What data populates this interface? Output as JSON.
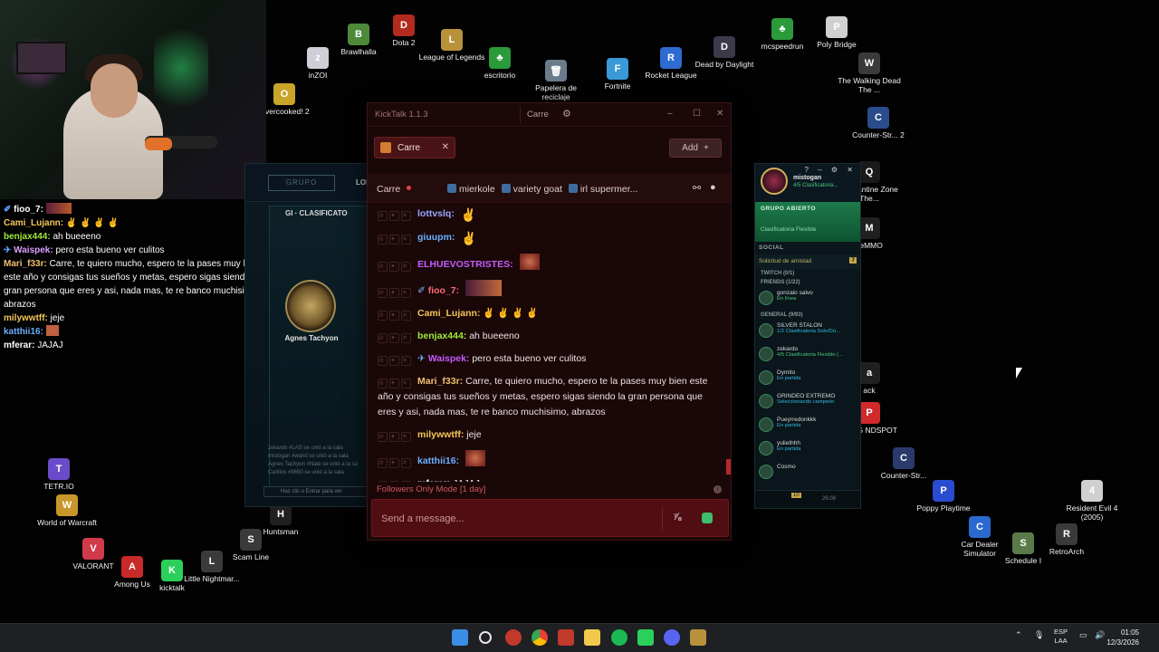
{
  "desktop_icons": [
    {
      "label": "Brawlhalla",
      "icon": "brawlhalla-icon",
      "color": "#4c8a3a",
      "glyph": "B"
    },
    {
      "label": "Dota 2",
      "icon": "dota2-icon",
      "color": "#b32a1e",
      "glyph": "D"
    },
    {
      "label": "League of Legends",
      "icon": "lol-icon",
      "color": "#b8923a",
      "glyph": "L"
    },
    {
      "label": "inZOI",
      "icon": "inzoi-icon",
      "color": "#cfcfd8",
      "glyph": "z"
    },
    {
      "label": "escritorio",
      "icon": "tree-icon",
      "color": "#2b9a3a",
      "glyph": "♣"
    },
    {
      "label": "Papelera de reciclaje",
      "icon": "recycle-bin-icon",
      "color": "#6a7c8c",
      "glyph": "🗑"
    },
    {
      "label": "Fortnite",
      "icon": "fortnite-icon",
      "color": "#3a9ad8",
      "glyph": "F"
    },
    {
      "label": "Rocket League",
      "icon": "rocket-league-icon",
      "color": "#2d6bd0",
      "glyph": "R"
    },
    {
      "label": "Dead by Daylight",
      "icon": "dbd-icon",
      "color": "#3a3a48",
      "glyph": "D"
    },
    {
      "label": "mcspeedrun",
      "icon": "tree-icon",
      "color": "#2b9a3a",
      "glyph": "♣"
    },
    {
      "label": "Poly Bridge",
      "icon": "polybridge-icon",
      "color": "#d0d0d0",
      "glyph": "P"
    },
    {
      "label": "The Walking Dead The ...",
      "icon": "twd-icon",
      "color": "#3a3a3a",
      "glyph": "W"
    },
    {
      "label": "Overcooked! 2",
      "icon": "overcooked-icon",
      "color": "#c8a52a",
      "glyph": "O"
    },
    {
      "label": "Counter-Str... 2",
      "icon": "cs2-icon",
      "color": "#2a4c8a",
      "glyph": "C"
    },
    {
      "label": "Quarantine Zone The...",
      "icon": "qz-icon",
      "color": "#1a1a1a",
      "glyph": "Q"
    },
    {
      "label": "ceMMO",
      "icon": "mmo-icon",
      "color": "#202020",
      "glyph": "M"
    },
    {
      "label": "ack",
      "icon": "app-icon",
      "color": "#202020",
      "glyph": "a"
    },
    {
      "label": "PUBG NDSPOT",
      "icon": "pubg-icon",
      "color": "#d02a2a",
      "glyph": "P"
    },
    {
      "label": "Counter-Str...",
      "icon": "cs-icon",
      "color": "#2a3a6a",
      "glyph": "C"
    },
    {
      "label": "Resident Evil 4 (2005)",
      "icon": "re4-icon",
      "color": "#d0d0d0",
      "glyph": "4"
    },
    {
      "label": "Poppy Playtime",
      "icon": "poppy-icon",
      "color": "#2a4cd0",
      "glyph": "P"
    },
    {
      "label": "Car Dealer Simulator",
      "icon": "cardealer-icon",
      "color": "#2a6ad0",
      "glyph": "C"
    },
    {
      "label": "Schedule I",
      "icon": "schedule-icon",
      "color": "#5a7a4a",
      "glyph": "S"
    },
    {
      "label": "RetroArch",
      "icon": "retroarch-icon",
      "color": "#3a3a3a",
      "glyph": "R"
    },
    {
      "label": "TETR.IO",
      "icon": "tetrio-icon",
      "color": "#6a4cc8",
      "glyph": "T"
    },
    {
      "label": "World of Warcraft",
      "icon": "wow-icon",
      "color": "#c8962a",
      "glyph": "W"
    },
    {
      "label": "VALORANT",
      "icon": "valorant-icon",
      "color": "#d03a4a",
      "glyph": "V"
    },
    {
      "label": "Among Us",
      "icon": "amongus-icon",
      "color": "#c82a2a",
      "glyph": "A"
    },
    {
      "label": "kicktalk",
      "icon": "kicktalk-icon",
      "color": "#2ad05a",
      "glyph": "K"
    },
    {
      "label": "Little Nightmar...",
      "icon": "ln-icon",
      "color": "#3a3a3a",
      "glyph": "L"
    },
    {
      "label": "Scam Line",
      "icon": "scamline-icon",
      "color": "#3a3a3a",
      "glyph": "S"
    },
    {
      "label": "Huntsman",
      "icon": "huntsman-icon",
      "color": "#202020",
      "glyph": "H"
    }
  ],
  "overlay_chat": [
    {
      "user": "fioo_7:",
      "color": "#ffffff",
      "text": "",
      "badge": "✐",
      "emote": "block"
    },
    {
      "user": "Cami_Lujann:",
      "color": "#f5c65a",
      "text": "✌ ✌ ✌ ✌",
      "badge": "",
      "emote": ""
    },
    {
      "user": "benjax444:",
      "color": "#9eea3a",
      "text": "ah bueeeno",
      "badge": "",
      "emote": ""
    },
    {
      "user": "Waispek:",
      "color": "#d9a0ff",
      "text": "pero esta bueno ver culitos",
      "badge": "✈",
      "emote": ""
    },
    {
      "user": "Mari_f33r:",
      "color": "#f0c070",
      "text": "Carre, te quiero mucho, espero te la pases muy bien este año y consigas tus sueños y metas, espero sigas siendo la gran persona que eres y asi, nada mas, te re banco muchisimo, abrazos",
      "badge": "",
      "emote": ""
    },
    {
      "user": "milywwtff:",
      "color": "#f5c65a",
      "text": "jeje",
      "badge": "",
      "emote": ""
    },
    {
      "user": "katthii16:",
      "color": "#6ab0ff",
      "text": "",
      "badge": "",
      "emote": "face"
    },
    {
      "user": "mferar:",
      "color": "#ffffff",
      "text": "JAJAJ",
      "badge": "",
      "emote": ""
    }
  ],
  "lol_client": {
    "grupo": "GRUPO",
    "lol_label": "LOL",
    "title": "GI · CLASIFICATO",
    "name": "Agnes Tachyon",
    "log": "zekardo #LAS se unió a la sala\nmistogan #wand se unió a la sala\nAgnes Tachyon #Nate se unió a la sa\nCarlitos #9650 se unió a la sala",
    "hint": "Haz clic o Entrar para ver"
  },
  "social_panel": {
    "username": "mistogan",
    "status": "4/5 Clasificatoria...",
    "group_title": "GRUPO ABIERTO",
    "group_sub": "Clasificatoria Flexible",
    "social_label": "SOCIAL",
    "friend_request": "Solicitud de amistad",
    "friend_request_count": "7",
    "twitch_group": "TWITCH (0/1)",
    "friends_group": "FRIENDS (1/22)",
    "general_group": "GENERAL (9/93)",
    "friends": [
      {
        "name": "gonzalo salvo",
        "status": "En línea",
        "game": false
      },
      {
        "name": "SILVER STALON",
        "status": "1/2 Clasificatoria Solo/Dú...",
        "game": true
      },
      {
        "name": "zekardo",
        "status": "4/5 Clasificatoria Flexible (...",
        "game": false
      },
      {
        "name": "Dymito",
        "status": "En partida",
        "game": true
      },
      {
        "name": "GRINDEO EXTREMO",
        "status": "Seleccionando campeón",
        "game": true
      },
      {
        "name": "Pueyrredonkkk",
        "status": "En partida",
        "game": true
      },
      {
        "name": "yuliethhh",
        "status": "En partida",
        "game": true
      },
      {
        "name": "Cosmo",
        "status": "",
        "game": true
      }
    ],
    "footer_count": "10",
    "footer_time": "26:08"
  },
  "kicktalk": {
    "app_title": "KickTalk 1.1.3",
    "title_channel": "Carre",
    "tab_label": "Carre",
    "add_label": "Add",
    "channel_name": "Carre",
    "pinned": [
      "mierkole",
      "variety goat",
      "irl supermer..."
    ],
    "messages": [
      {
        "user": "lottvslq:",
        "color": "#9aa6ff",
        "text": "",
        "emote": "✌",
        "badge": ""
      },
      {
        "user": "giuupm:",
        "color": "#6ab0ff",
        "text": "",
        "emote": "✌",
        "badge": ""
      },
      {
        "user": "ELHUEVOSTRISTES:",
        "color": "#c65cff",
        "text": "",
        "emote": "face",
        "badge": ""
      },
      {
        "user": "fioo_7:",
        "color": "#ff6b7a",
        "text": "",
        "emote": "block",
        "badge": "✐"
      },
      {
        "user": "Cami_Lujann:",
        "color": "#f5c65a",
        "text": "✌ ✌ ✌ ✌",
        "emote": "",
        "badge": ""
      },
      {
        "user": "benjax444:",
        "color": "#9eea3a",
        "text": "ah bueeeno",
        "emote": "",
        "badge": ""
      },
      {
        "user": "Waispek:",
        "color": "#c65cff",
        "text": "pero esta bueno ver culitos",
        "emote": "",
        "badge": "✈"
      },
      {
        "user": "Mari_f33r:",
        "color": "#f0c070",
        "text": "Carre, te quiero mucho, espero te la pases muy bien este año y consigas tus sueños y metas, espero sigas siendo la gran persona que eres y asi, nada mas, te re banco muchisimo, abrazos",
        "emote": "",
        "badge": ""
      },
      {
        "user": "milywwtff:",
        "color": "#f5c65a",
        "text": "jeje",
        "emote": "",
        "badge": ""
      },
      {
        "user": "katthii16:",
        "color": "#6ab0ff",
        "text": "",
        "emote": "face",
        "badge": ""
      },
      {
        "user": "mferar:",
        "color": "#ffffff",
        "text": "JAJAJ",
        "emote": "",
        "badge": ""
      }
    ],
    "followers_mode": "Followers Only Mode [1 day]",
    "input_placeholder": "Send a message...",
    "accent": "#72151b"
  },
  "taskbar": {
    "language": "ESP",
    "layout": "LAA",
    "time": "01:05",
    "date": "12/3/2026"
  }
}
